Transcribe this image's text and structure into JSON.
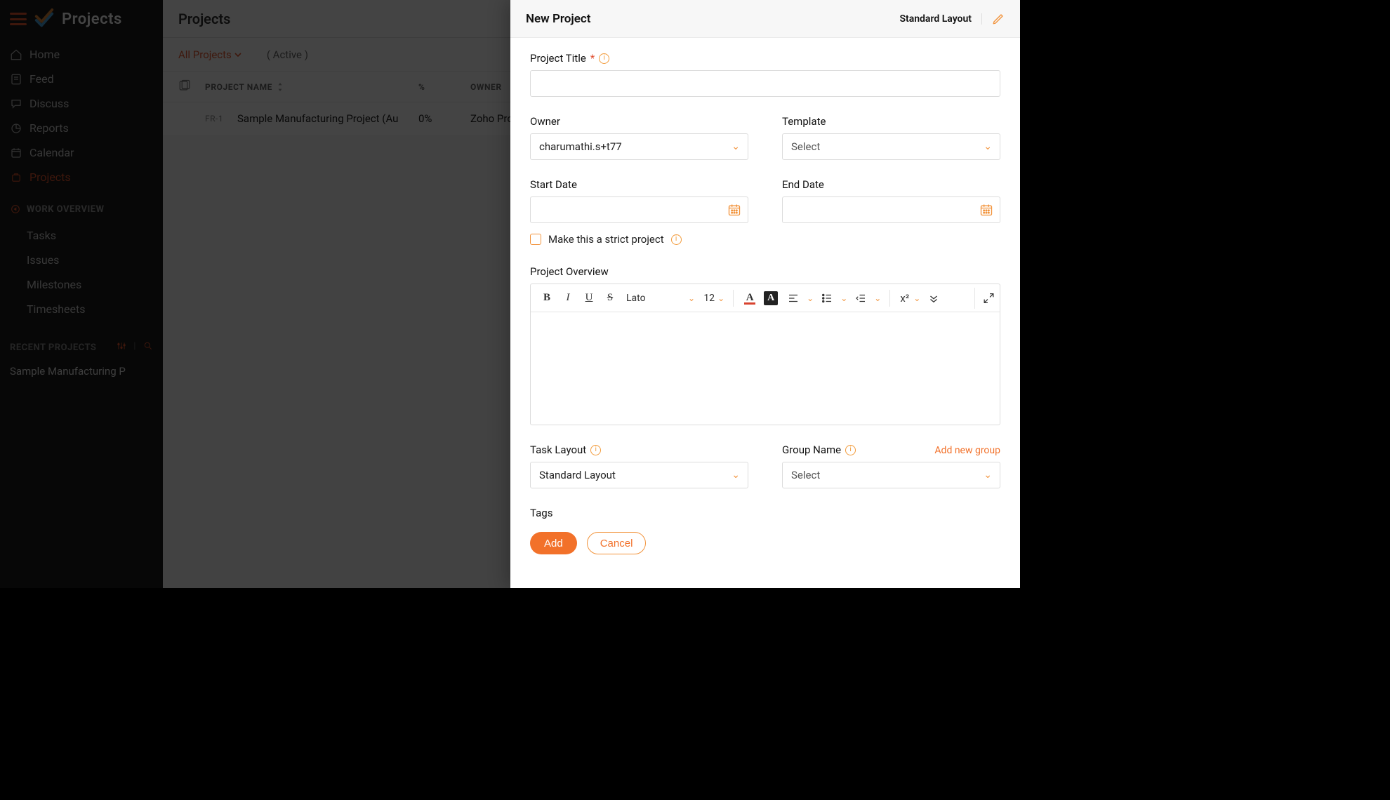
{
  "brand": "Projects",
  "sidebar": {
    "nav": [
      {
        "label": "Home"
      },
      {
        "label": "Feed"
      },
      {
        "label": "Discuss"
      },
      {
        "label": "Reports"
      },
      {
        "label": "Calendar"
      },
      {
        "label": "Projects"
      }
    ],
    "work_overview_head": "WORK OVERVIEW",
    "work_overview": [
      {
        "label": "Tasks"
      },
      {
        "label": "Issues"
      },
      {
        "label": "Milestones"
      },
      {
        "label": "Timesheets"
      }
    ],
    "recent_head": "RECENT PROJECTS",
    "recent": [
      {
        "label": "Sample Manufacturing P"
      }
    ]
  },
  "main": {
    "title": "Projects",
    "filter_label": "All Projects",
    "status_label": "( Active )",
    "columns": {
      "name": "PROJECT NAME",
      "pct": "%",
      "owner": "OWNER"
    },
    "rows": [
      {
        "id": "FR-1",
        "name": "Sample Manufacturing Project (Au",
        "pct": "0%",
        "owner": "Zoho Project"
      }
    ]
  },
  "drawer": {
    "title": "New Project",
    "layout_name": "Standard Layout",
    "labels": {
      "project_title": "Project Title",
      "owner": "Owner",
      "template": "Template",
      "start_date": "Start Date",
      "end_date": "End Date",
      "strict_checkbox": "Make this a strict project",
      "overview": "Project Overview",
      "task_layout": "Task Layout",
      "group_name": "Group Name",
      "tags": "Tags",
      "add_group_link": "Add new group"
    },
    "values": {
      "project_title": "",
      "owner": "charumathi.s+t77",
      "template": "Select",
      "start_date": "",
      "end_date": "",
      "task_layout": "Standard Layout",
      "group_name": "Select"
    },
    "rte": {
      "font_name": "Lato",
      "font_size": "12",
      "superscript_sample": "x²"
    },
    "buttons": {
      "add": "Add",
      "cancel": "Cancel"
    }
  }
}
